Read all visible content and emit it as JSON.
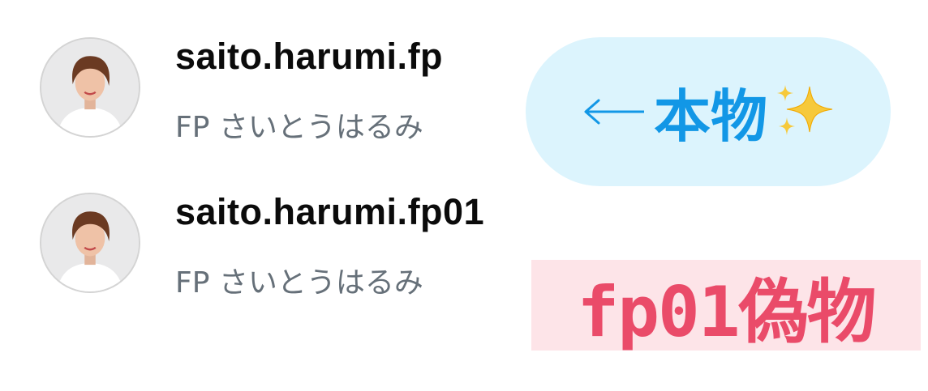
{
  "accounts": [
    {
      "username": "saito.harumi.fp",
      "display_name": "FP さいとうはるみ"
    },
    {
      "username": "saito.harumi.fp01",
      "display_name": "FP さいとうはるみ"
    }
  ],
  "annotations": {
    "real": {
      "label": "本物",
      "color": "#1297e6",
      "background": "#dcf4fd",
      "icon": "sparkles-icon"
    },
    "fake": {
      "label": "fp01偽物",
      "color": "#ea4b69",
      "background": "#fde4e8"
    }
  }
}
